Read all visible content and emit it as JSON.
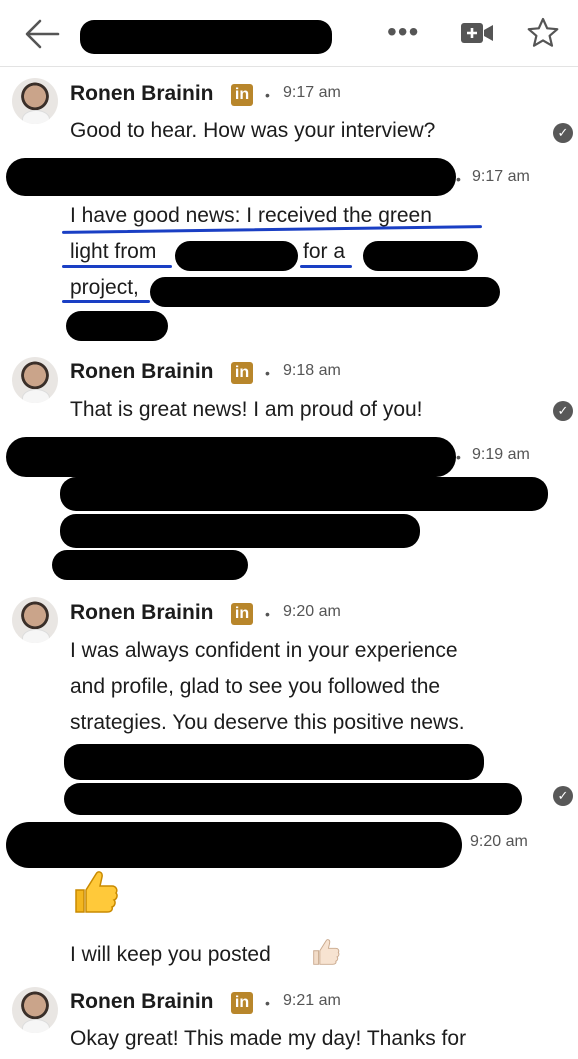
{
  "header": {
    "back_icon": "arrow-left-icon",
    "more_icon": "more-dots-icon",
    "more_label": "•••",
    "video_icon": "video-call-icon",
    "star_icon": "star-outline-icon"
  },
  "colors": {
    "linkedin_badge": "#b8862b",
    "underline": "#1a3fc4",
    "check": "#585858"
  },
  "messages": [
    {
      "sender": "Ronen Brainin",
      "badge": "in",
      "sep": "•",
      "time": "9:17 am",
      "text": "Good to hear. How was your interview?",
      "read": "✓"
    },
    {
      "sep": "•",
      "time": "9:17 am",
      "lines": [
        "I have good news: I received the green",
        "light from",
        "for a",
        "project,"
      ]
    },
    {
      "sender": "Ronen Brainin",
      "badge": "in",
      "sep": "•",
      "time": "9:18 am",
      "text": "That is great news! I am proud of you!",
      "read": "✓"
    },
    {
      "sep": "•",
      "time": "9:19 am"
    },
    {
      "sender": "Ronen Brainin",
      "badge": "in",
      "sep": "•",
      "time": "9:20 am",
      "lines": [
        "I was always confident in your experience",
        "and profile, glad to see you followed the",
        "strategies. You deserve this positive news."
      ],
      "read": "✓"
    },
    {
      "time": "9:20 am",
      "emoji": "thumbs-up-icon",
      "text": "I will keep you posted",
      "emoji2": "thumbs-up-light-icon"
    },
    {
      "sender": "Ronen Brainin",
      "badge": "in",
      "sep": "•",
      "time": "9:21 am",
      "text": "Okay great! This made my day! Thanks for"
    }
  ]
}
